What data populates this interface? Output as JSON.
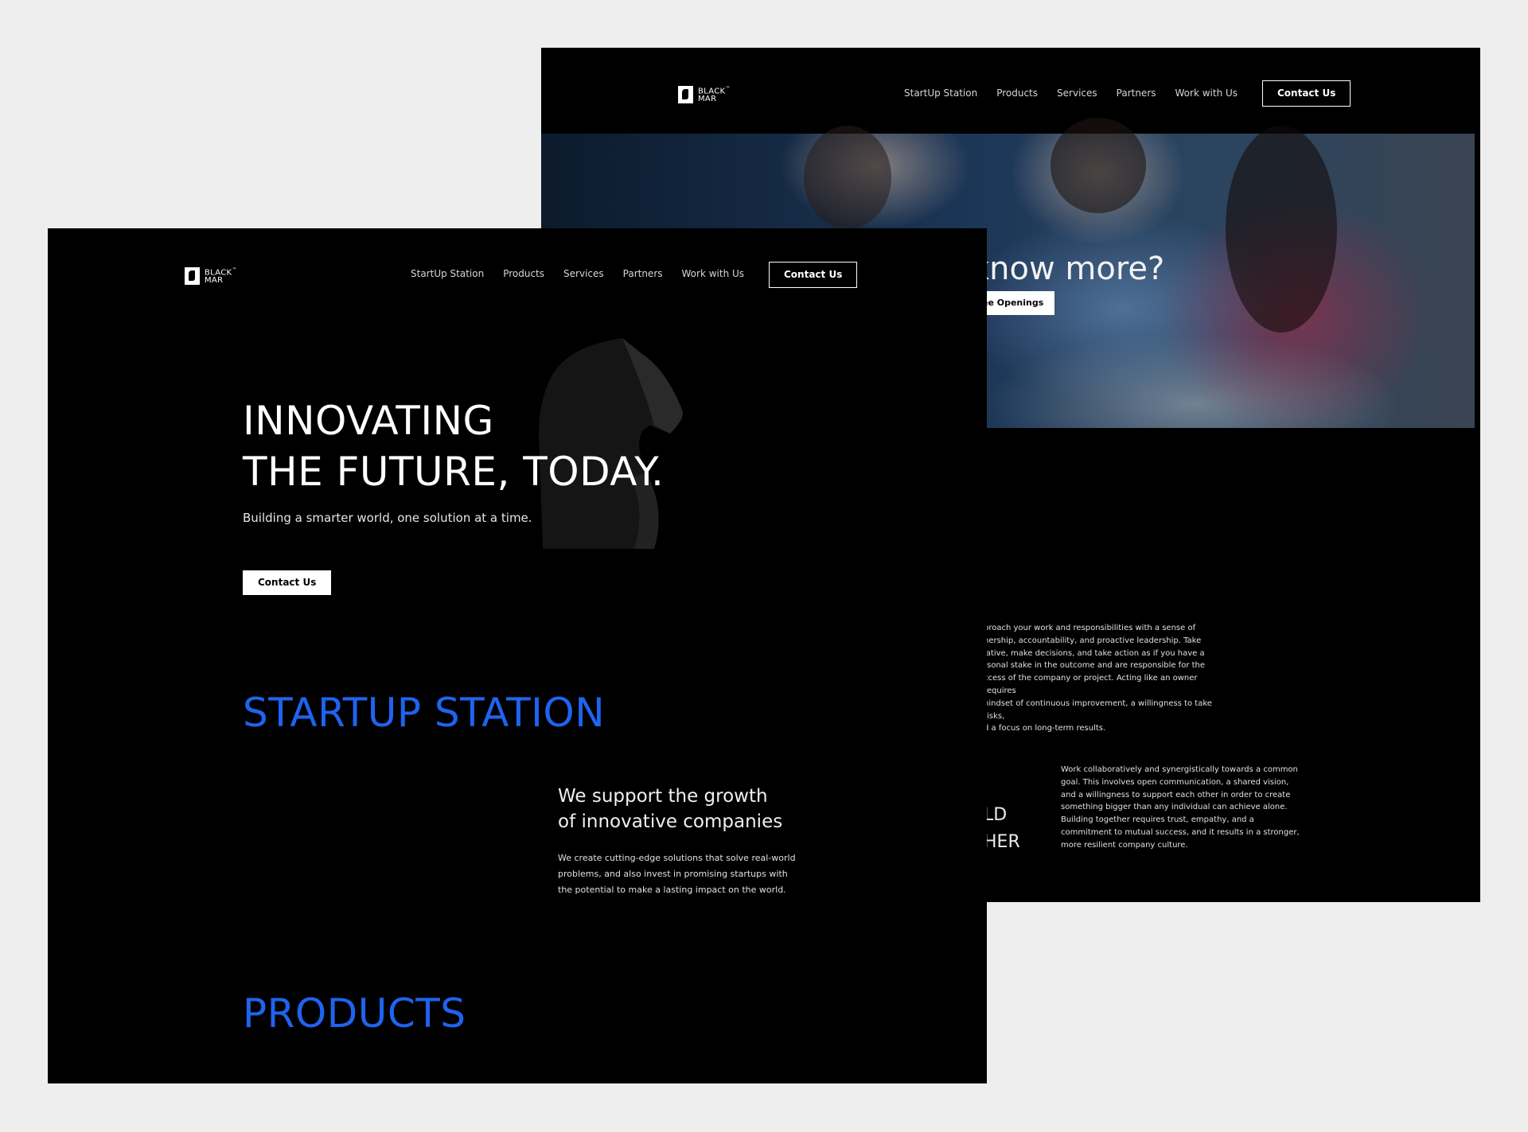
{
  "back_screen": {
    "logo": {
      "line1": "BLACK",
      "line2": "MAR",
      "mark": "™"
    },
    "nav": {
      "links": [
        "StartUp Station",
        "Products",
        "Services",
        "Partners",
        "Work with Us"
      ],
      "cta": "Contact Us"
    },
    "hero": {
      "partial_title": "know more?",
      "partial_button": "ee Openings"
    },
    "paragraph_ownership": [
      "proach your work and responsibilities with a sense of",
      "nership, accountability, and proactive leadership. Take",
      "iative, make decisions, and take action as if you have a",
      "rsonal stake in the outcome and are responsible for the",
      "ccess of the company or project. Acting like an owner requires",
      "nindset of continuous improvement, a willingness to take risks,",
      "d a focus on long-term results."
    ],
    "partial_heading": [
      "LD",
      "HER"
    ],
    "paragraph_collaboration": [
      "Work collaboratively and synergistically towards a common",
      "goal. This involves open communication, a shared vision,",
      "and a willingness to support each other in order to create",
      "something bigger than any individual can achieve alone.",
      "Building together requires trust, empathy, and a",
      "commitment to mutual success, and it results in a stronger,",
      "more resilient company culture."
    ]
  },
  "front_screen": {
    "logo": {
      "line1": "BLACK",
      "line2": "MAR",
      "mark": "™"
    },
    "nav": {
      "links": [
        "StartUp Station",
        "Products",
        "Services",
        "Partners",
        "Work with Us"
      ],
      "cta": "Contact Us"
    },
    "hero": {
      "title_line1": "INNOVATING",
      "title_line2": "THE FUTURE, TODAY.",
      "subtitle": "Building a smarter world, one solution at a time.",
      "cta": "Contact Us"
    },
    "startup_station": {
      "heading": "STARTUP STATION",
      "title_line1": "We support the growth",
      "title_line2": "of innovative companies",
      "body": [
        "We create cutting-edge solutions that solve real-world",
        "problems, and also invest in promising startups with",
        "the potential to make a lasting impact on the world."
      ]
    },
    "products": {
      "heading": "PRODUCTS"
    }
  },
  "colors": {
    "accent_blue": "#1f63f0",
    "background": "#000000",
    "canvas": "#eeeeee"
  },
  "icons": {
    "logo": "knight-chess-logo-icon",
    "hero_art": "knight-chess-3d-icon"
  }
}
